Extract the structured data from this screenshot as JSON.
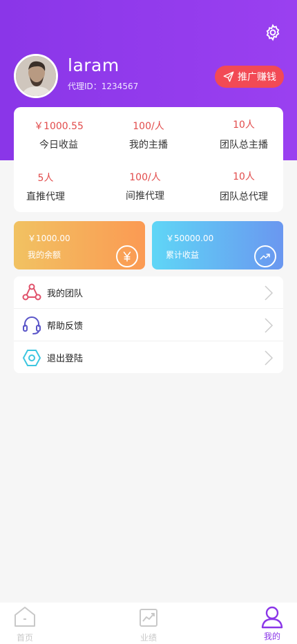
{
  "profile": {
    "username": "laram",
    "agent_id": "代理ID：1234567",
    "promo_button": "推广赚钱"
  },
  "stats": [
    {
      "value": "￥1000.55",
      "label": "今日收益"
    },
    {
      "value": "100/人",
      "label": "我的主播"
    },
    {
      "value": "10人",
      "label": "团队总主播"
    },
    {
      "value": "5人",
      "label": "直推代理"
    },
    {
      "value": "100/人",
      "label": "间推代理"
    },
    {
      "value": "10人",
      "label": "团队总代理"
    }
  ],
  "balance": {
    "amount": "￥1000.00",
    "label": "我的余额",
    "icon": "yen-icon"
  },
  "earnings": {
    "amount": "￥50000.00",
    "label": "累计收益",
    "icon": "trend-icon"
  },
  "menu": [
    {
      "label": "我的团队",
      "icon": "team-icon"
    },
    {
      "label": "帮助反馈",
      "icon": "headset-icon"
    },
    {
      "label": "退出登陆",
      "icon": "logout-hex-icon"
    }
  ],
  "tabs": [
    {
      "label": "首页",
      "icon": "home-icon"
    },
    {
      "label": "业绩",
      "icon": "chart-icon"
    },
    {
      "label": "我的",
      "icon": "user-icon",
      "active": true
    }
  ],
  "colors": {
    "brand": "#8a36e8",
    "accent_red": "#f24a55",
    "stat_value": "#e24b4b"
  }
}
